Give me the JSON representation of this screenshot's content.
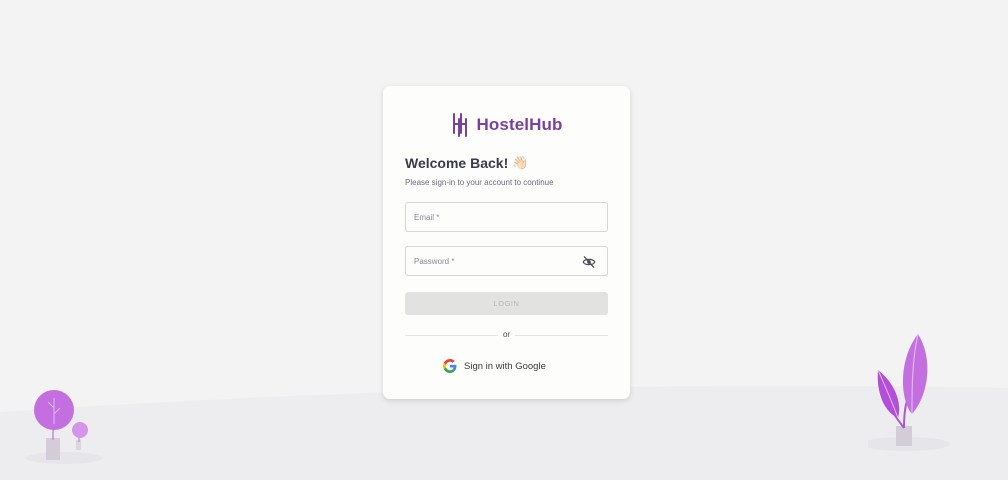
{
  "brand": {
    "name": "HostelHub",
    "color": "#7b3fa0"
  },
  "heading": {
    "title": "Welcome Back!",
    "emoji": "👋🏻",
    "subtitle": "Please sign-in to your account to continue"
  },
  "form": {
    "email_label": "Email *",
    "password_label": "Password *",
    "login_label": "LOGIN"
  },
  "divider": {
    "text": "or"
  },
  "google": {
    "label": "Sign in with Google"
  },
  "icons": {
    "logo": "hostelhub-logo-icon",
    "password_toggle": "eye-slash-icon",
    "google": "google-icon",
    "plants": [
      "round-tree-illustration",
      "leaf-plant-illustration"
    ]
  },
  "colors": {
    "accent": "#b35fd6",
    "background": "#f3f3f3",
    "card": "#fdfdfc",
    "button_disabled": "#e2e2e2"
  }
}
